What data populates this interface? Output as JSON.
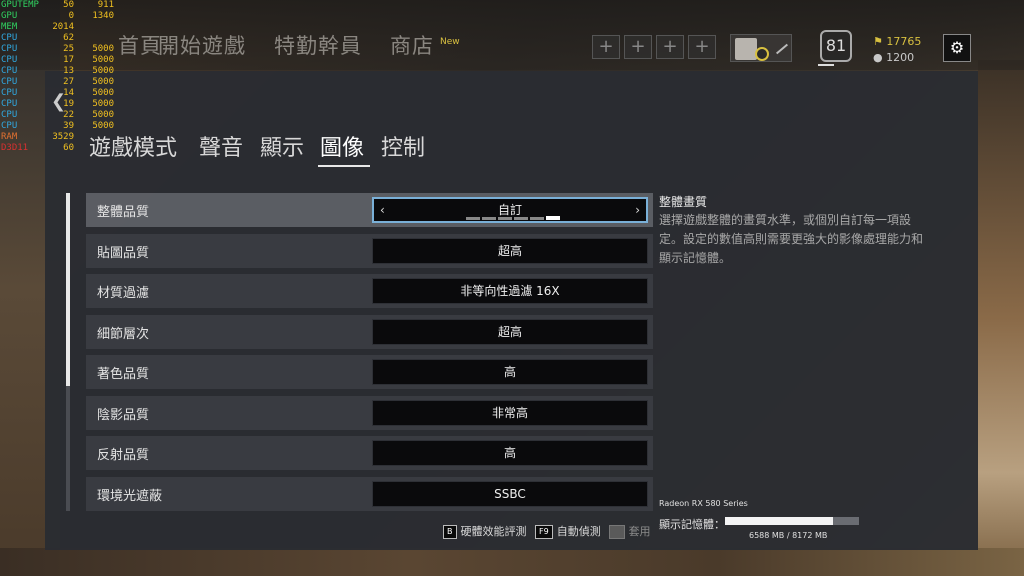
{
  "top_nav": {
    "items": [
      "首頁",
      "開始遊戲",
      "特勤幹員",
      "商店"
    ],
    "store_badge": "New",
    "player_level": "81",
    "renown": "17765",
    "credits": "1200"
  },
  "hw_monitor": [
    {
      "label": "GPUTEMP",
      "v1": "50",
      "v2": "911",
      "kind": "gpu"
    },
    {
      "label": "GPU",
      "v1": "0",
      "v2": "1340",
      "kind": "gpu"
    },
    {
      "label": "MEM",
      "v1": "2014",
      "v2": "",
      "kind": "gpu"
    },
    {
      "label": "CPU",
      "v1": "62",
      "v2": "",
      "kind": "cpu"
    },
    {
      "label": "CPU",
      "v1": "25",
      "v2": "5000",
      "kind": "cpu"
    },
    {
      "label": "CPU",
      "v1": "17",
      "v2": "5000",
      "kind": "cpu"
    },
    {
      "label": "CPU",
      "v1": "13",
      "v2": "5000",
      "kind": "cpu"
    },
    {
      "label": "CPU",
      "v1": "27",
      "v2": "5000",
      "kind": "cpu"
    },
    {
      "label": "CPU",
      "v1": "14",
      "v2": "5000",
      "kind": "cpu"
    },
    {
      "label": "CPU",
      "v1": "19",
      "v2": "5000",
      "kind": "cpu"
    },
    {
      "label": "CPU",
      "v1": "22",
      "v2": "5000",
      "kind": "cpu"
    },
    {
      "label": "CPU",
      "v1": "39",
      "v2": "5000",
      "kind": "cpu"
    },
    {
      "label": "RAM",
      "v1": "3529",
      "v2": "",
      "kind": "ram"
    },
    {
      "label": "D3D11",
      "v1": "60",
      "v2": "",
      "kind": "d3d"
    }
  ],
  "tabs": [
    "遊戲模式",
    "聲音",
    "顯示",
    "圖像",
    "控制"
  ],
  "active_tab": 3,
  "settings": [
    {
      "label": "整體品質",
      "value": "自訂",
      "selected": true
    },
    {
      "label": "貼圖品質",
      "value": "超高"
    },
    {
      "label": "材質過濾",
      "value": "非等向性過濾 16X"
    },
    {
      "label": "細節層次",
      "value": "超高"
    },
    {
      "label": "著色品質",
      "value": "高"
    },
    {
      "label": "陰影品質",
      "value": "非常高"
    },
    {
      "label": "反射品質",
      "value": "高"
    },
    {
      "label": "環境光遮蔽",
      "value": "SSBC"
    }
  ],
  "quality_level": {
    "steps": 6,
    "filled": 5
  },
  "description": {
    "title": "整體畫質",
    "body": "選擇遊戲整體的畫質水準，或個別自訂每一項設定。設定的數值高則需要更強大的影像處理能力和顯示記憶體。"
  },
  "gpu": {
    "name": "Radeon RX 580 Series",
    "vram_label": "顯示記憶體：",
    "vram_used_mb": 6588,
    "vram_total_mb": 8172,
    "vram_text": "6588 MB / 8172 MB"
  },
  "actions": {
    "benchmark_key": "B",
    "benchmark_label": "硬體效能評測",
    "autodetect_key": "F9",
    "autodetect_label": "自動偵測",
    "apply_key": "■",
    "apply_label": "套用"
  }
}
